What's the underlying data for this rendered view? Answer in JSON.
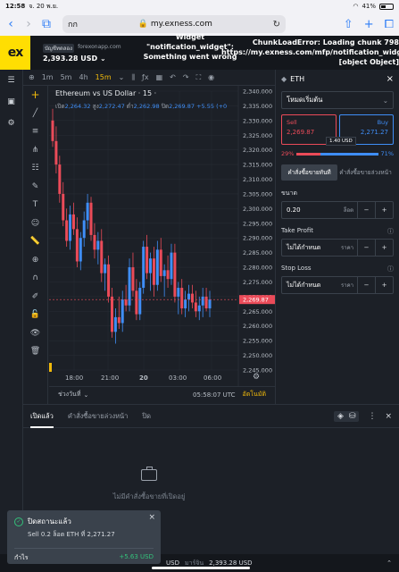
{
  "status": {
    "time": "12:58",
    "date": "จ. 20 พ.ย.",
    "battery": "41%"
  },
  "browser": {
    "aa": "กก",
    "url": "my.exness.com"
  },
  "header": {
    "logo": "ex",
    "account_type": "บัญชีทดลอง",
    "server": "forexonapp.com",
    "balance": "2,393.28 USD",
    "error_widget": "Widget \"notification_widget\": Something went wrong",
    "error_chunk": "ChunkLoadError: Loading chunk 798 https://my.exness.com/mfp/notification_widget [object Object]"
  },
  "chart_toolbar": {
    "timeframes": [
      "1m",
      "5m",
      "4h",
      "15m"
    ],
    "active_timeframe": "15m"
  },
  "chart": {
    "title": "Ethereum vs US Dollar · 15 ·",
    "ohlc": {
      "open_label": "เปิด",
      "open": "2,264.32",
      "high_label": "สูง",
      "high": "2,272.47",
      "low_label": "ต่ำ",
      "low": "2,262.98",
      "close_label": "ปิด",
      "close": "2,269.87",
      "change": "+5.55 (+0"
    },
    "price_label": "2,269.87",
    "time_ticks": [
      "18:00",
      "21:00",
      "20",
      "03:00",
      "06:00"
    ],
    "range_label": "ช่วงวันที่",
    "utc": "05:58:07 UTC",
    "auto_label": "อัตโนมัติ"
  },
  "chart_data": {
    "type": "candlestick",
    "ylim": [
      2245,
      2340
    ],
    "yticks": [
      2340,
      2335,
      2330,
      2325,
      2320,
      2315,
      2310,
      2305,
      2300,
      2295,
      2290,
      2285,
      2280,
      2275,
      2270,
      2265,
      2260,
      2255,
      2250,
      2245
    ],
    "candles": [
      [
        2330,
        2334,
        2321,
        2323
      ],
      [
        2323,
        2328,
        2312,
        2315
      ],
      [
        2315,
        2318,
        2302,
        2305
      ],
      [
        2305,
        2309,
        2294,
        2296
      ],
      [
        2296,
        2300,
        2287,
        2289
      ],
      [
        2289,
        2301,
        2286,
        2298
      ],
      [
        2298,
        2302,
        2291,
        2293
      ],
      [
        2293,
        2297,
        2280,
        2282
      ],
      [
        2282,
        2292,
        2279,
        2290
      ],
      [
        2290,
        2299,
        2287,
        2296
      ],
      [
        2296,
        2305,
        2293,
        2302
      ],
      [
        2302,
        2304,
        2289,
        2291
      ],
      [
        2291,
        2295,
        2283,
        2286
      ],
      [
        2286,
        2292,
        2281,
        2289
      ],
      [
        2289,
        2293,
        2275,
        2278
      ],
      [
        2278,
        2283,
        2272,
        2281
      ],
      [
        2281,
        2284,
        2268,
        2270
      ],
      [
        2270,
        2273,
        2256,
        2258
      ],
      [
        2258,
        2266,
        2254,
        2263
      ],
      [
        2263,
        2270,
        2259,
        2261
      ],
      [
        2261,
        2272,
        2258,
        2269
      ],
      [
        2269,
        2274,
        2265,
        2267
      ],
      [
        2267,
        2283,
        2265,
        2280
      ],
      [
        2280,
        2285,
        2270,
        2272
      ],
      [
        2272,
        2276,
        2262,
        2264
      ],
      [
        2264,
        2275,
        2262,
        2273
      ],
      [
        2273,
        2289,
        2271,
        2287
      ],
      [
        2287,
        2291,
        2276,
        2278
      ],
      [
        2278,
        2285,
        2272,
        2283
      ],
      [
        2283,
        2287,
        2270,
        2274
      ],
      [
        2274,
        2289,
        2272,
        2286
      ],
      [
        2286,
        2290,
        2275,
        2277
      ],
      [
        2277,
        2281,
        2270,
        2279
      ],
      [
        2279,
        2284,
        2273,
        2276
      ],
      [
        2276,
        2288,
        2274,
        2285
      ],
      [
        2285,
        2288,
        2268,
        2270
      ],
      [
        2270,
        2275,
        2264,
        2273
      ],
      [
        2273,
        2276,
        2264,
        2266
      ],
      [
        2266,
        2272,
        2263,
        2269
      ],
      [
        2269,
        2274,
        2265,
        2271
      ],
      [
        2271,
        2274,
        2266,
        2268
      ],
      [
        2268,
        2272,
        2263,
        2265
      ],
      [
        2265,
        2270,
        2262,
        2267
      ],
      [
        2267,
        2273,
        2263,
        2270
      ],
      [
        2270,
        2273,
        2265,
        2266
      ],
      [
        2266,
        2272,
        2263,
        2269
      ]
    ],
    "up_color": "#3f8ef7",
    "down_color": "#eb4b59"
  },
  "order_panel": {
    "symbol": "ETH",
    "mode": "โหมดเริ่มต้น",
    "sell_label": "Sell",
    "sell_price": "2,269.87",
    "buy_label": "Buy",
    "buy_price": "2,271.27",
    "spread": "1.40 USD",
    "sell_pct_label": "29%",
    "buy_pct_label": "71%",
    "sell_pct": 0.29,
    "market_tab": "คำสั่งซื้อขายทันที",
    "pending_tab": "คำสั่งซื้อขายล่วงหน้า",
    "volume_label": "ขนาด",
    "volume": "0.20",
    "volume_unit": "ล็อต",
    "tp_label": "Take Profit",
    "tp_value": "ไม่ได้กำหนด",
    "tp_unit": "ราคา",
    "sl_label": "Stop Loss",
    "sl_value": "ไม่ได้กำหนด",
    "sl_unit": "ราคา"
  },
  "orders": {
    "tabs": [
      "เปิดแล้ว",
      "คำสั่งซื้อขายล่วงหน้า",
      "ปิด"
    ],
    "empty": "ไม่มีคำสั่งซื้อขายที่เปิดอยู่"
  },
  "footer": {
    "currency": "USD",
    "equity_label": "มาร์จิน",
    "equity": "2,393.28 USD"
  },
  "toast": {
    "title": "ปิดสถานะแล้ว",
    "detail": "Sell 0.2 ล็อต ETH ที่ 2,271.27",
    "profit_label": "กำไร",
    "profit": "+5.63 USD"
  }
}
